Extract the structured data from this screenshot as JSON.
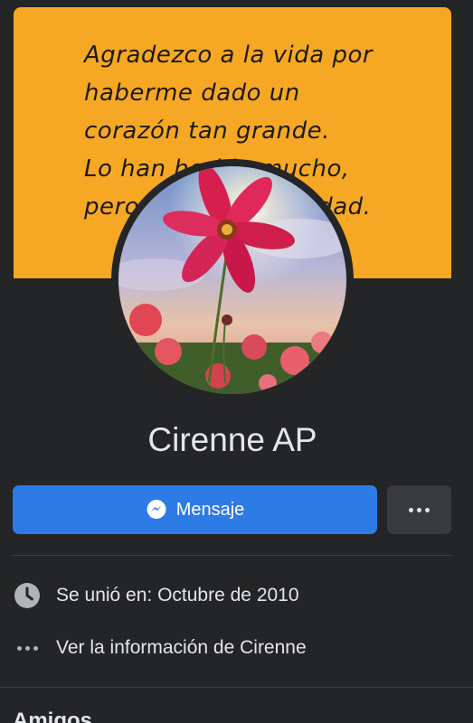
{
  "cover": {
    "lines": [
      "Agradezco a la vida por",
      "haberme dado un",
      "corazón tan grande.",
      "Lo han herido mucho,",
      "pero sigue con bondad."
    ],
    "bg_color": "#f6a825"
  },
  "profile": {
    "name": "Cirenne AP",
    "avatar": "pink-cosmos-flower-photo"
  },
  "actions": {
    "message_label": "Mensaje",
    "message_icon": "messenger-icon",
    "more_icon": "more-dots-icon",
    "accent_color": "#2d7be5"
  },
  "info": {
    "joined": "Se unió en: Octubre de 2010",
    "joined_icon": "clock-icon",
    "see_info": "Ver la información de Cirenne",
    "see_info_icon": "more-dots-icon"
  },
  "friends": {
    "title": "Amigos"
  }
}
